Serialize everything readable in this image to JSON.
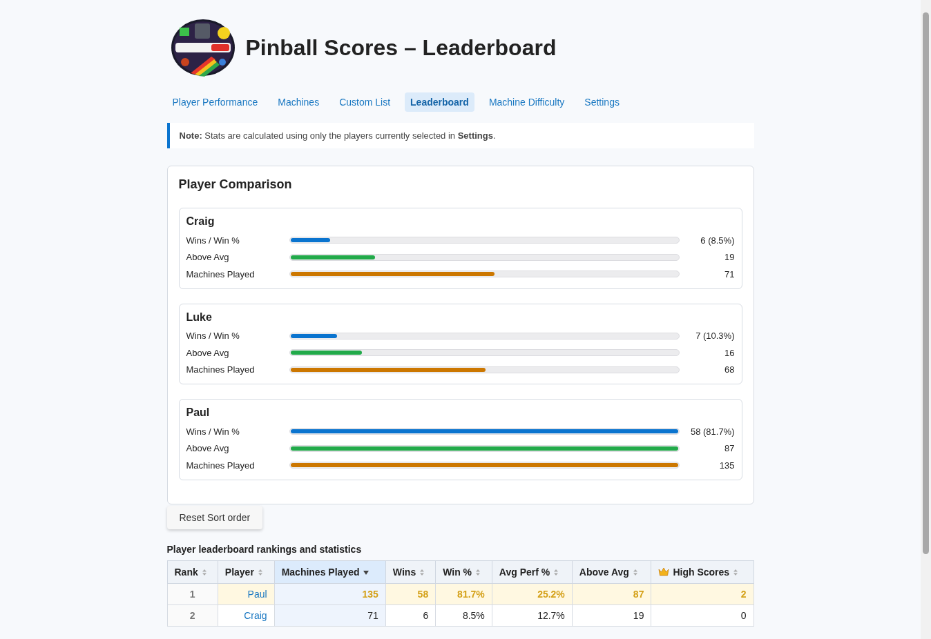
{
  "header": {
    "title": "Pinball Scores – Leaderboard"
  },
  "tabs": [
    {
      "label": "Player Performance",
      "selected": false
    },
    {
      "label": "Machines",
      "selected": false
    },
    {
      "label": "Custom List",
      "selected": false
    },
    {
      "label": "Leaderboard",
      "selected": true
    },
    {
      "label": "Machine Difficulty",
      "selected": false
    },
    {
      "label": "Settings",
      "selected": false
    }
  ],
  "note": "**Note:** Stats are calculated using only the players currently selected in **Settings**.",
  "comparison": {
    "title": "Player Comparison",
    "players": [
      {
        "name": "Craig",
        "metrics": [
          {
            "kind": "wins",
            "label": "Wins / Win %",
            "level": 0.103,
            "reading": "6 (8.5%)"
          },
          {
            "kind": "above",
            "label": "Above Avg",
            "level": 0.218,
            "reading": "19"
          },
          {
            "kind": "played",
            "label": "Machines Played",
            "level": 0.526,
            "reading": "71"
          }
        ]
      },
      {
        "name": "Luke",
        "metrics": [
          {
            "kind": "wins",
            "label": "Wins / Win %",
            "level": 0.121,
            "reading": "7 (10.3%)"
          },
          {
            "kind": "above",
            "label": "Above Avg",
            "level": 0.184,
            "reading": "16"
          },
          {
            "kind": "played",
            "label": "Machines Played",
            "level": 0.504,
            "reading": "68"
          }
        ]
      },
      {
        "name": "Paul",
        "metrics": [
          {
            "kind": "wins",
            "label": "Wins / Win %",
            "level": 1,
            "reading": "58 (81.7%)"
          },
          {
            "kind": "above",
            "label": "Above Avg",
            "level": 1,
            "reading": "87"
          },
          {
            "kind": "played",
            "label": "Machines Played",
            "level": 1,
            "reading": "135"
          }
        ]
      }
    ]
  },
  "reset_button": "Reset Sort order",
  "table": {
    "caption": "Player leaderboard rankings and statistics",
    "columns": [
      {
        "label": "Rank",
        "kind": "sortable"
      },
      {
        "label": "Player",
        "kind": "sortable"
      },
      {
        "label": "Machines Played",
        "kind": "sorted"
      },
      {
        "label": "Wins",
        "kind": "sortable"
      },
      {
        "label": "Win %",
        "kind": "sortable"
      },
      {
        "label": "Avg Perf %",
        "kind": "sortable"
      },
      {
        "label": "Above Avg",
        "kind": "sortable"
      },
      {
        "label": "High Scores",
        "kind": "crown"
      }
    ],
    "rows": [
      {
        "leader": true,
        "cells": [
          "1",
          "Paul",
          "135",
          "58",
          "81.7%",
          "25.2%",
          "87",
          "2"
        ]
      },
      {
        "leader": false,
        "cells": [
          "2",
          "Craig",
          "71",
          "6",
          "8.5%",
          "12.7%",
          "19",
          "0"
        ]
      }
    ]
  }
}
